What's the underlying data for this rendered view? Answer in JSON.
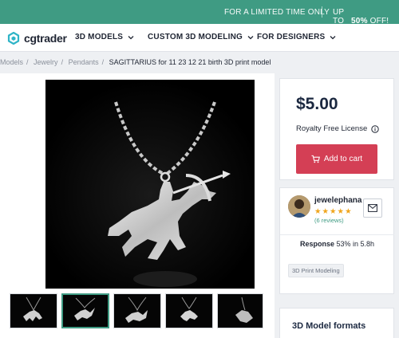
{
  "promo": {
    "left_text": "FOR A LIMITED TIME ONLY",
    "up_to": "UP TO",
    "pct": "50%",
    "off": "OFF!"
  },
  "nav": {
    "logo": "cgtrader",
    "items": [
      "3D MODELS",
      "CUSTOM 3D MODELING",
      "FOR DESIGNERS"
    ]
  },
  "breadcrumbs": [
    {
      "label": "Models"
    },
    {
      "label": "Jewelry"
    },
    {
      "label": "Pendants"
    },
    {
      "label": "SAGITTARIUS for 11 23 12 21 birth 3D print model"
    }
  ],
  "breadcrumb_sep": "/",
  "product": {
    "price": "$5.00",
    "license": "Royalty Free License",
    "add_to_cart": "Add to cart"
  },
  "seller": {
    "name": "jewelephana",
    "stars": "★★★★★",
    "reviews": "(6 reviews)",
    "response_label": "Response",
    "response_value": "53% in 5.8h",
    "tag": "3D Print Modeling"
  },
  "formats": {
    "title": "3D Model formats"
  },
  "colors": {
    "promo_bg": "#3f9b83",
    "cart_button": "#d43f55",
    "star": "#f0a51c"
  },
  "icons": [
    "logo-mark",
    "chevron-down-icon",
    "info-icon",
    "cart-icon",
    "message-icon"
  ]
}
